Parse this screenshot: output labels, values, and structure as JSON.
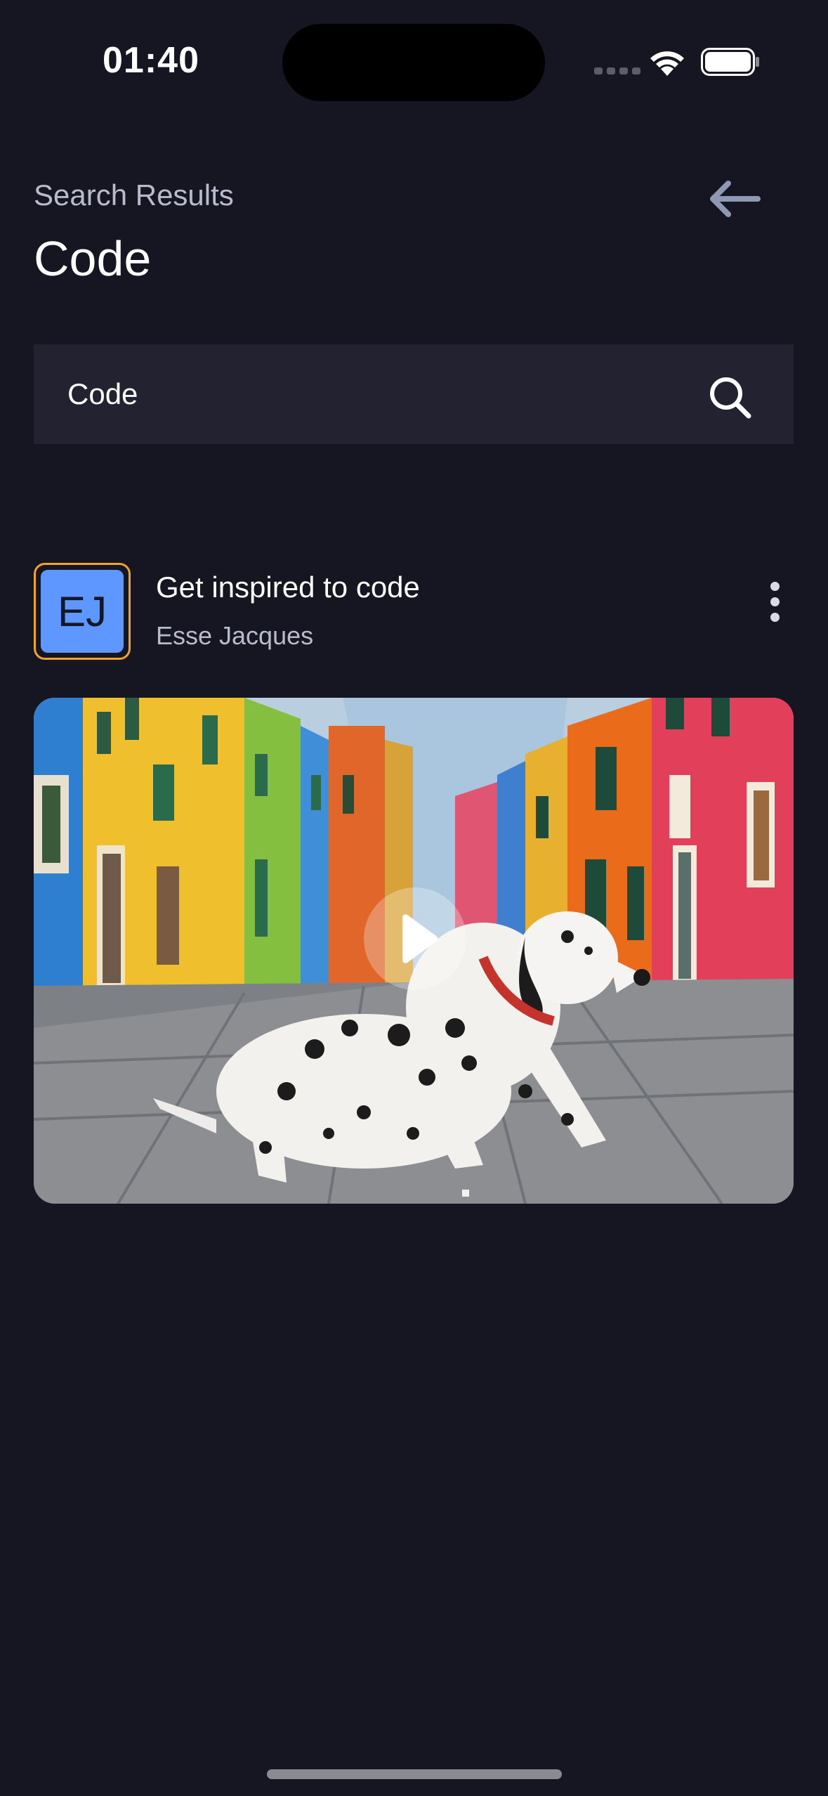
{
  "status_bar": {
    "time": "01:40"
  },
  "header": {
    "subtitle": "Search Results",
    "title": "Code",
    "back_icon": "arrow-left-icon"
  },
  "search": {
    "value": "Code",
    "placeholder": "",
    "icon": "search-icon"
  },
  "results": [
    {
      "avatar_initials": "EJ",
      "title": "Get inspired to code",
      "author": "Esse Jacques",
      "thumbnail_description_icon": "play-icon"
    }
  ],
  "colors": {
    "background": "#161622",
    "search_bg": "#222231",
    "avatar_bg": "#5d97ff",
    "avatar_border": "#f2a12b",
    "muted_text": "#b9bbcc",
    "back_arrow": "#8f98b3"
  }
}
